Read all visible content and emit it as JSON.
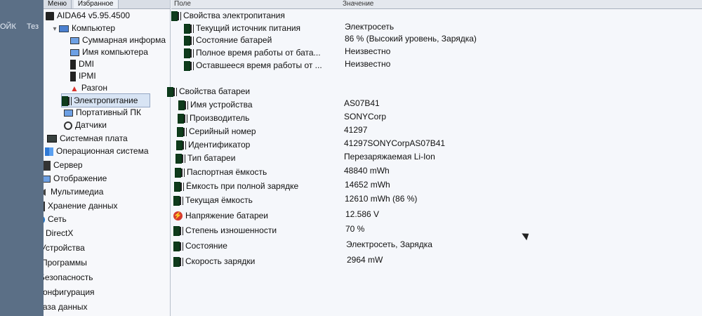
{
  "desktop": {
    "left_text_1": "ОЙК",
    "left_text_2": "Тез"
  },
  "tabs": [
    "Меню",
    "Избранное"
  ],
  "columns": {
    "field": "Поле",
    "value": "Значение"
  },
  "tree": [
    {
      "label": "AIDA64 v5.95.4500",
      "icon": "aida-icon",
      "level": "root"
    },
    {
      "label": "Компьютер",
      "icon": "computer-icon",
      "level": "1"
    },
    {
      "label": "Суммарная информа",
      "icon": "summary-icon",
      "level": "2"
    },
    {
      "label": "Имя компьютера",
      "icon": "monitor-icon",
      "level": "2"
    },
    {
      "label": "DMI",
      "icon": "dmi-icon",
      "level": "2"
    },
    {
      "label": "IPMI",
      "icon": "ipmi-icon",
      "level": "2"
    },
    {
      "label": "Разгон",
      "icon": "flame-icon",
      "level": "2"
    },
    {
      "label": "Электропитание",
      "icon": "battery-icon",
      "level": "2",
      "selected": true
    },
    {
      "label": "Портативный ПК",
      "icon": "laptop-icon",
      "level": "2"
    },
    {
      "label": "Датчики",
      "icon": "sensor-icon",
      "level": "2"
    },
    {
      "label": "Системная плата",
      "icon": "motherboard-icon",
      "level": "1"
    },
    {
      "label": "Операционная система",
      "icon": "windows-icon",
      "level": "1"
    },
    {
      "label": "Сервер",
      "icon": "server-icon",
      "level": "1"
    },
    {
      "label": "Отображение",
      "icon": "display-icon",
      "level": "1"
    },
    {
      "label": "Мультимедиа",
      "icon": "speaker-icon",
      "level": "1"
    },
    {
      "label": "Хранение данных",
      "icon": "storage-icon",
      "level": "1"
    },
    {
      "label": "Сеть",
      "icon": "globe-icon",
      "level": "1"
    },
    {
      "label": "DirectX",
      "icon": "xbox-icon",
      "level": "1"
    },
    {
      "label": "Устройства",
      "icon": "devices-icon",
      "level": "1"
    },
    {
      "label": "Программы",
      "icon": "programs-icon",
      "level": "1"
    },
    {
      "label": "Безопасность",
      "icon": "shield-icon",
      "level": "1"
    },
    {
      "label": "Конфигурация",
      "icon": "gear-icon",
      "level": "1"
    },
    {
      "label": "База данных",
      "icon": "database-icon",
      "level": "1"
    }
  ],
  "power_section": {
    "title": "Свойства электропитания",
    "rows": [
      {
        "field": "Текущий источник питания",
        "value": "Электросеть"
      },
      {
        "field": "Состояние батарей",
        "value": "86 % (Высокий уровень, Зарядка)"
      },
      {
        "field": "Полное время работы от бата...",
        "value": "Неизвестно"
      },
      {
        "field": "Оставшееся время работы от ...",
        "value": "Неизвестно"
      }
    ]
  },
  "battery_section": {
    "title": "Свойства батареи",
    "rows": [
      {
        "field": "Имя устройства",
        "value": "AS07B41"
      },
      {
        "field": "Производитель",
        "value": "SONYCorp"
      },
      {
        "field": "Серийный номер",
        "value": "41297"
      },
      {
        "field": "Идентификатор",
        "value": "41297SONYCorpAS07B41"
      },
      {
        "field": "Тип батареи",
        "value": "Перезаряжаемая Li-Ion"
      },
      {
        "field": "Паспортная ёмкость",
        "value": "48840 mWh"
      },
      {
        "field": "Ёмкость при полной зарядке",
        "value": "14652 mWh"
      },
      {
        "field": "Текущая ёмкость",
        "value": "12610 mWh  (86 %)"
      },
      {
        "field": "Напряжение батареи",
        "value": "12.586 V",
        "icon": "voltage-icon"
      },
      {
        "field": "Степень изношенности",
        "value": "70 %"
      },
      {
        "field": "Состояние",
        "value": "Электросеть, Зарядка"
      },
      {
        "field": "Скорость зарядки",
        "value": "2964 mW"
      }
    ]
  }
}
